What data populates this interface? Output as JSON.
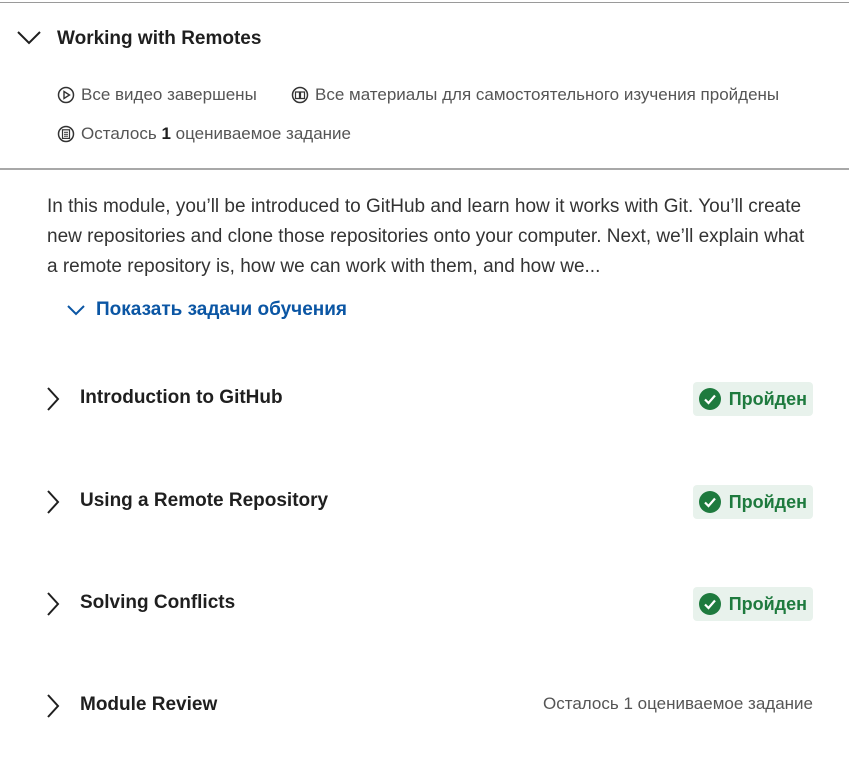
{
  "module": {
    "title": "Working with Remotes",
    "status": {
      "videos": "Все видео завершены",
      "readings": "Все материалы для самостоятельного изучения пройдены",
      "remaining_prefix": "Осталось",
      "remaining_count": "1",
      "remaining_suffix": "оцениваемое задание"
    },
    "description": "In this module, you’ll be introduced to GitHub and learn how it works with Git. You’ll create new repositories and clone those repositories onto your computer. Next, we’ll explain what a remote repository is, how we can work with them, and how we...",
    "show_objectives_label": "Показать задачи обучения"
  },
  "lessons": [
    {
      "title": "Introduction to GitHub",
      "status": "Пройден"
    },
    {
      "title": "Using a Remote Repository",
      "status": "Пройден"
    },
    {
      "title": "Solving Conflicts",
      "status": "Пройден"
    },
    {
      "title": "Module Review",
      "status": "Осталось 1 оцениваемое задание"
    }
  ],
  "colors": {
    "accent_link": "#0b56a4",
    "completed_green": "#1e7a3e",
    "completed_bg": "#e8f2ec"
  },
  "icons": {
    "module_toggle": "chevron-down-icon",
    "videos": "play-circle-icon",
    "readings": "book-icon",
    "assignments": "assignment-icon",
    "lesson_toggle": "chevron-right-icon",
    "completed": "check-circle-icon"
  }
}
